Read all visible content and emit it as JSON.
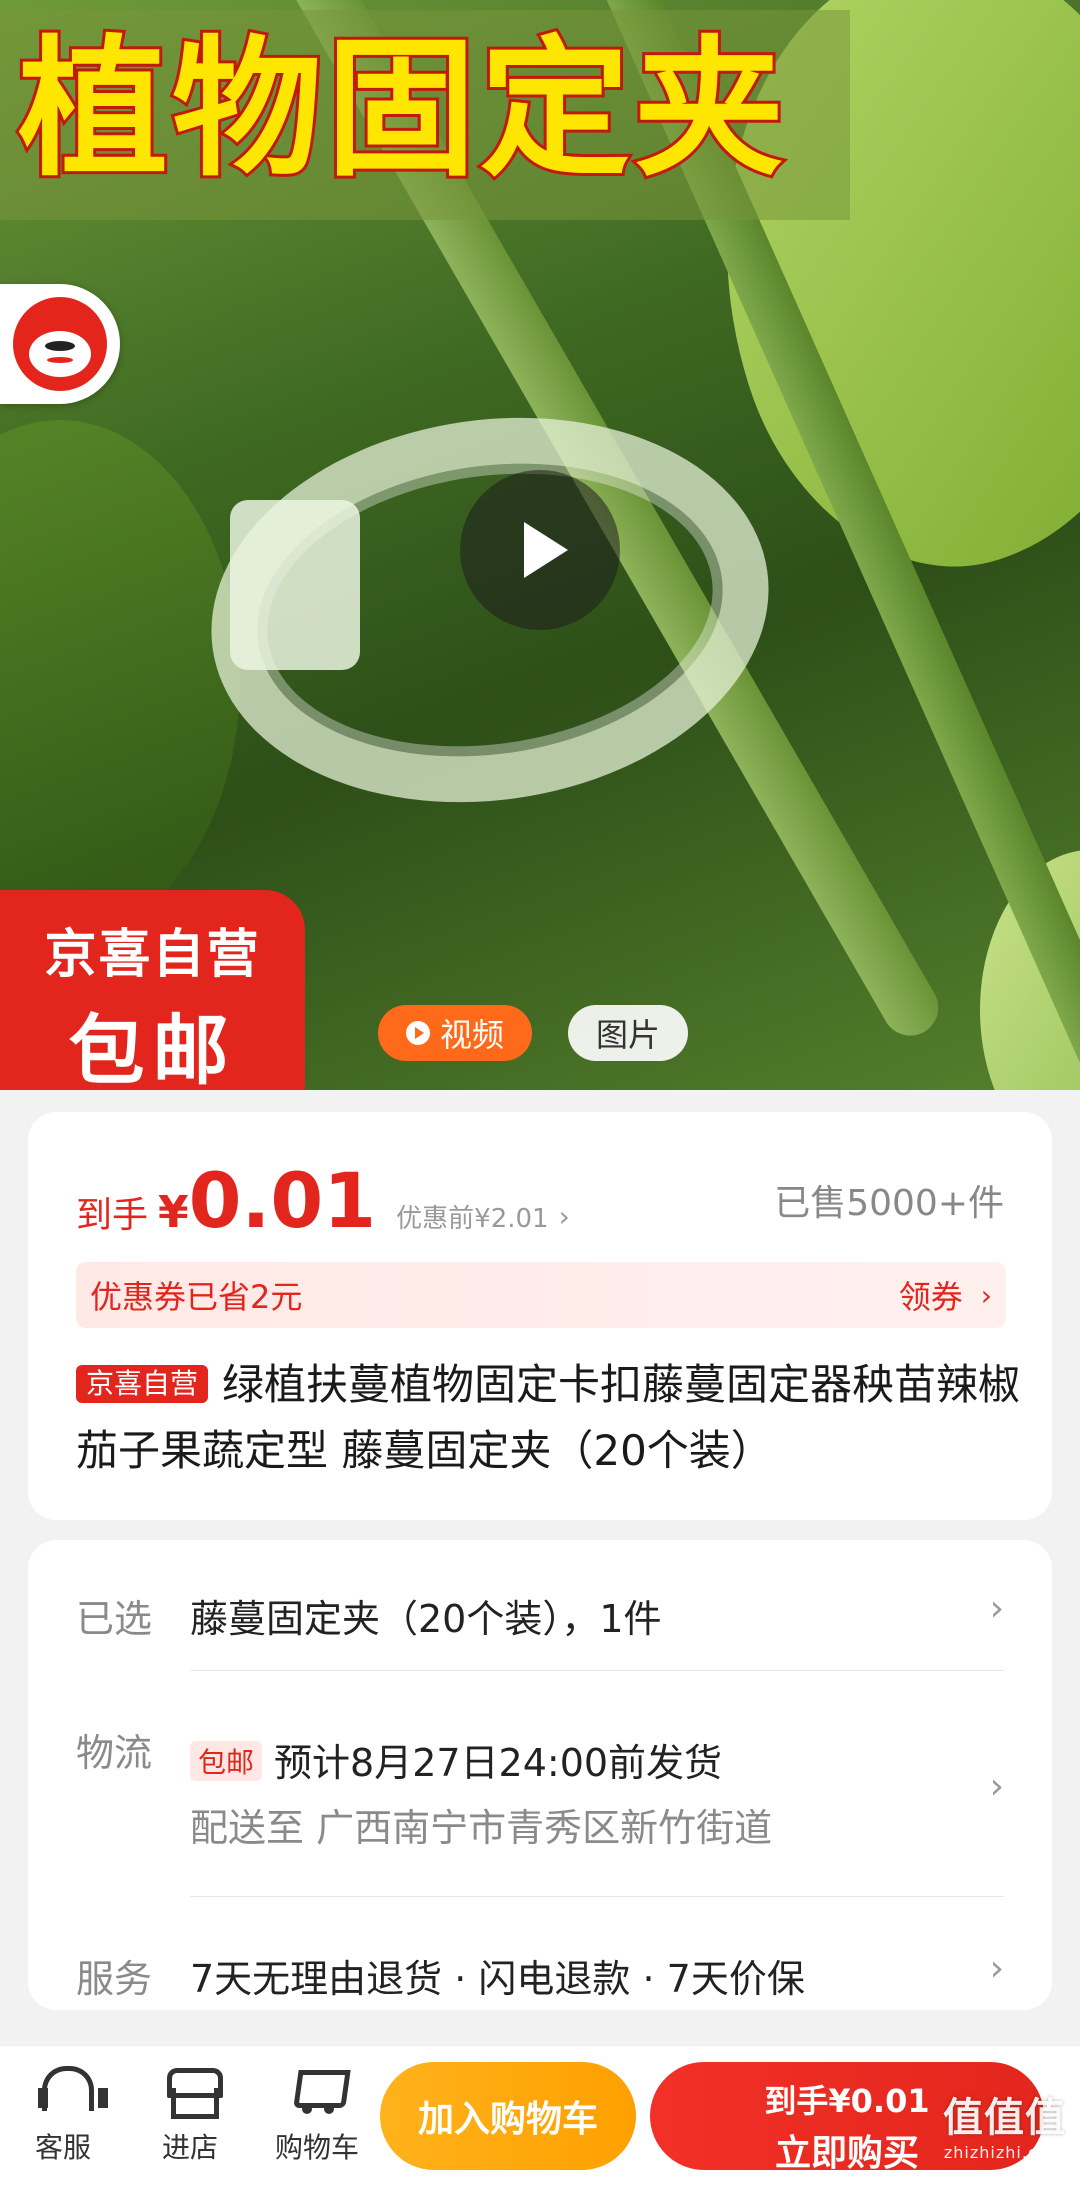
{
  "hero": {
    "title": "植物固定夹",
    "promo_line1": "京喜自营",
    "promo_line2": "包邮",
    "tab_video": "视频",
    "tab_image": "图片"
  },
  "price": {
    "prefix": "到手",
    "yen": "¥",
    "value": "0.01",
    "before": "优惠前¥2.01",
    "sold": "已售5000+件"
  },
  "coupon": {
    "text": "优惠券已省2元",
    "action": "领券"
  },
  "product": {
    "tag": "京喜自营",
    "title": "绿植扶蔓植物固定卡扣藤蔓固定器秧苗辣椒茄子果蔬定型 藤蔓固定夹（20个装）"
  },
  "info": {
    "selected_label": "已选",
    "selected_value": "藤蔓固定夹（20个装），1件",
    "logistics_label": "物流",
    "shipping_tag": "包邮",
    "delivery": "预计8月27日24:00前发货",
    "address": "配送至 广西南宁市青秀区新竹街道",
    "service_label": "服务",
    "service_value": "7天无理由退货 · 闪电退款 · 7天价保"
  },
  "bottom": {
    "service": "客服",
    "store": "进店",
    "cart": "购物车",
    "add_cart": "加入购物车",
    "buy_price": "到手¥0.01",
    "buy_now": "立即购买"
  },
  "watermark": {
    "main": "值值值",
    "site": "zhizhizhi.com"
  },
  "colors": {
    "accent": "#e3261d",
    "orange": "#ffa000",
    "video_tab": "#ff6a1a"
  }
}
